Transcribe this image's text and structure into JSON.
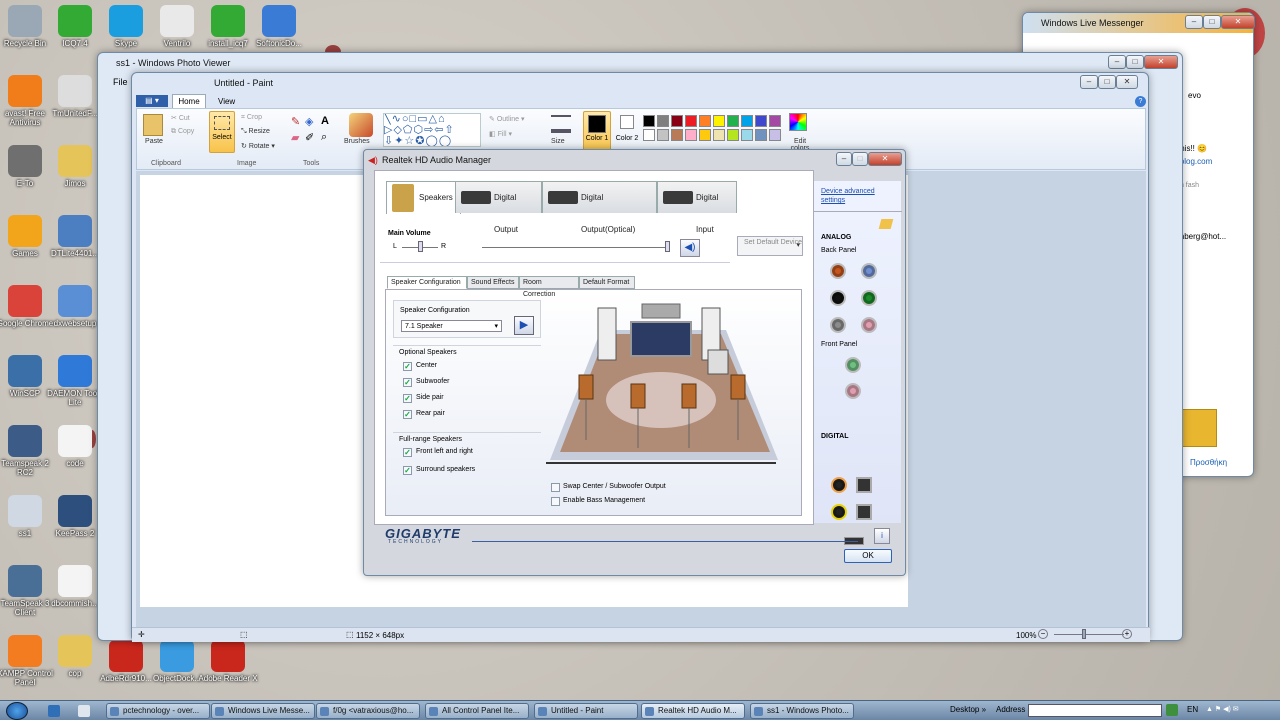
{
  "desktop": {
    "icons": [
      {
        "label": "Recycle Bin",
        "color": "#9aa7b4"
      },
      {
        "label": "ICQ7.4",
        "color": "#33aa33"
      },
      {
        "label": "Skype",
        "color": "#1a9ee0"
      },
      {
        "label": "Ventrilo",
        "color": "#e9e9e9"
      },
      {
        "label": "install_icq7",
        "color": "#33aa33"
      },
      {
        "label": "SoftonicDo...",
        "color": "#3a7bd5"
      },
      {
        "label": "avast! Free Antivirus",
        "color": "#f07d19"
      },
      {
        "label": "TmUnitedF...",
        "color": "#dddddd"
      },
      {
        "label": "E-To",
        "color": "#6f6f6f"
      },
      {
        "label": "Jimos",
        "color": "#e5c55a"
      },
      {
        "label": "Games",
        "color": "#f2a41a"
      },
      {
        "label": "DTLite4401...",
        "color": "#4c7fc1"
      },
      {
        "label": "Google Chrome",
        "color": "#d9433a"
      },
      {
        "label": "dxwebsetup",
        "color": "#5a8fd6"
      },
      {
        "label": "WinSCP",
        "color": "#3b6fa8"
      },
      {
        "label": "DAEMON Tools Lite",
        "color": "#2f7ad9"
      },
      {
        "label": "Teamspeak 2 RC2",
        "color": "#3c5b87"
      },
      {
        "label": "code",
        "color": "#f4f4f4"
      },
      {
        "label": "ss1",
        "color": "#cfd8e3"
      },
      {
        "label": "KeePass 2",
        "color": "#2c4f7d"
      },
      {
        "label": "TeamSpeak 3 Client",
        "color": "#4a6f97"
      },
      {
        "label": "dbcommish...",
        "color": "#f4f4f4"
      },
      {
        "label": "XAMPP Control Panel",
        "color": "#f47c20"
      },
      {
        "label": "cop",
        "color": "#e5c55a"
      },
      {
        "label": "AdbeRdr910...",
        "color": "#c9261c"
      },
      {
        "label": "ObjectDock...",
        "color": "#3a9be0"
      },
      {
        "label": "Adobe Reader X",
        "color": "#c9261c"
      }
    ]
  },
  "messenger": {
    "title": "Windows Live Messenger",
    "snippets": [
      "evo",
      "this!! 😊",
      "iblog.com",
      "th fash",
      "inberg@hot...",
      "Προσθήκη"
    ]
  },
  "photo_viewer": {
    "title": "ss1 - Windows Photo Viewer",
    "file_menu": "File"
  },
  "paint": {
    "title": "Untitled - Paint",
    "tabs": [
      "Home",
      "View"
    ],
    "groups": [
      "Clipboard",
      "Image",
      "Tools"
    ],
    "clipboard": {
      "paste": "Paste",
      "cut": "Cut",
      "copy": "Copy"
    },
    "image": {
      "select": "Select",
      "crop": "Crop",
      "resize": "Resize",
      "rotate": "Rotate"
    },
    "brushes": "Brushes",
    "outline": "Outline",
    "fill": "Fill",
    "size": "Size",
    "color1": "Color 1",
    "color2": "Color 2",
    "edit_colors": "Edit colors",
    "palette_top": [
      "#000000",
      "#7f7f7f",
      "#880015",
      "#ed1c24",
      "#ff7f27",
      "#fff200",
      "#22b14c",
      "#00a2e8",
      "#3f48cc",
      "#a349a4"
    ],
    "palette_bottom": [
      "#ffffff",
      "#c3c3c3",
      "#b97a57",
      "#ffaec9",
      "#ffc90e",
      "#efe4b0",
      "#b5e61d",
      "#99d9ea",
      "#7092be",
      "#c8bfe7"
    ],
    "status": {
      "dimensions": "1152 × 648px",
      "zoom": "100%"
    }
  },
  "realtek": {
    "title": "Realtek HD Audio Manager",
    "tabs": [
      "Speakers",
      "Digital Output",
      "Digital Output(Optical)",
      "Digital Input"
    ],
    "device_advanced": "Device advanced settings",
    "main_volume": "Main Volume",
    "vol_l": "L",
    "vol_r": "R",
    "volume_level": 1.0,
    "set_default": "Set Default Device",
    "subtabs": [
      "Speaker Configuration",
      "Sound Effects",
      "Room Correction",
      "Default Format"
    ],
    "speaker_config_label": "Speaker Configuration",
    "speaker_config_value": "7.1 Speaker",
    "optional_header": "Optional Speakers",
    "optional": [
      {
        "label": "Center",
        "checked": true
      },
      {
        "label": "Subwoofer",
        "checked": true
      },
      {
        "label": "Side pair",
        "checked": true
      },
      {
        "label": "Rear pair",
        "checked": true
      }
    ],
    "fullrange_header": "Full-range Speakers",
    "fullrange": [
      {
        "label": "Front left and right",
        "checked": true
      },
      {
        "label": "Surround speakers",
        "checked": true
      }
    ],
    "swap_label": "Swap Center / Subwoofer Output",
    "bass_label": "Enable Bass Management",
    "analog": "ANALOG",
    "back_panel": "Back Panel",
    "front_panel": "Front Panel",
    "digital": "DIGITAL",
    "brand": "GIGABYTE",
    "brand_sub": "TECHNOLOGY",
    "ok": "OK",
    "jack_colors": {
      "back": [
        "#c5561f",
        "#6f8fd0",
        "#111111",
        "#1a8a2a",
        "#8c8c8c",
        "#e09fb0"
      ],
      "front": [
        "#6fbf82",
        "#e09fb0"
      ]
    }
  },
  "taskbar": {
    "items": [
      "pctechnology - over...",
      "Windows Live Messe...",
      "f/0g <vatraxious@ho...",
      "All Control Panel Ite...",
      "Untitled - Paint",
      "Realtek HD Audio M...",
      "ss1 - Windows Photo..."
    ],
    "desktop_label": "Desktop",
    "address_label": "Address",
    "lang": "EN"
  }
}
